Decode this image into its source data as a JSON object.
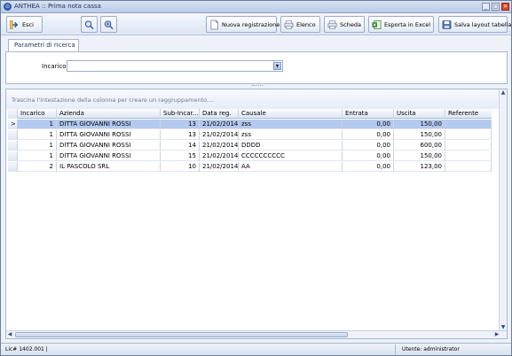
{
  "window": {
    "title": "ANTHEA :: Prima nota cassa",
    "app_icon_glyph": "⊙",
    "controls": {
      "minimize": "_",
      "maximize": "□",
      "close": "✕"
    }
  },
  "toolbar": {
    "esci_label": "Esci",
    "nuova_registrazione_label": "Nuova registrazione",
    "elenco_label": "Elenco",
    "scheda_label": "Scheda",
    "esporta_excel_label": "Esporta in Excel",
    "salva_layout_label": "Salva layout tabella"
  },
  "search_panel": {
    "tab_label": "Parametri di ricerca",
    "incarico_label": "Incarico",
    "incarico_value": "",
    "dropdown_glyph": "▼"
  },
  "grid": {
    "group_hint": "Trascina l'intestazione della colonna per creare un raggruppamento....",
    "columns": [
      "Incarico",
      "Azienda",
      "Sub-Incar...",
      "Data reg.",
      "Causale",
      "Entrata",
      "Uscita",
      "Referente"
    ],
    "rows": [
      {
        "incarico": "1",
        "azienda": "DITTA GIOVANNI ROSSI",
        "sub_incarico": "13",
        "data_reg": "21/02/2014",
        "causale": "zss",
        "entrata": "0,00",
        "uscita": "150,00",
        "referente": "",
        "selected": true
      },
      {
        "incarico": "1",
        "azienda": "DITTA GIOVANNI ROSSI",
        "sub_incarico": "13",
        "data_reg": "21/02/2014",
        "causale": "zss",
        "entrata": "0,00",
        "uscita": "150,00",
        "referente": "",
        "selected": false
      },
      {
        "incarico": "1",
        "azienda": "DITTA GIOVANNI ROSSI",
        "sub_incarico": "14",
        "data_reg": "21/02/2014",
        "causale": "DDDD",
        "entrata": "0,00",
        "uscita": "600,00",
        "referente": "",
        "selected": false
      },
      {
        "incarico": "1",
        "azienda": "DITTA GIOVANNI ROSSI",
        "sub_incarico": "15",
        "data_reg": "21/02/2014",
        "causale": "CCCCCCCCCC",
        "entrata": "0,00",
        "uscita": "150,00",
        "referente": "",
        "selected": false
      },
      {
        "incarico": "2",
        "azienda": "IL PASCOLO SRL",
        "sub_incarico": "10",
        "data_reg": "21/02/2014",
        "causale": "AA",
        "entrata": "0,00",
        "uscita": "123,00",
        "referente": "",
        "selected": false
      }
    ],
    "row_indicator": ">"
  },
  "statusbar": {
    "license": "Lic# 1402.001 |",
    "user": "Utente: administrator"
  },
  "colors": {
    "selection": "#b3c9ee",
    "accent": "#2e5aa8",
    "close_button": "#d9472b"
  }
}
